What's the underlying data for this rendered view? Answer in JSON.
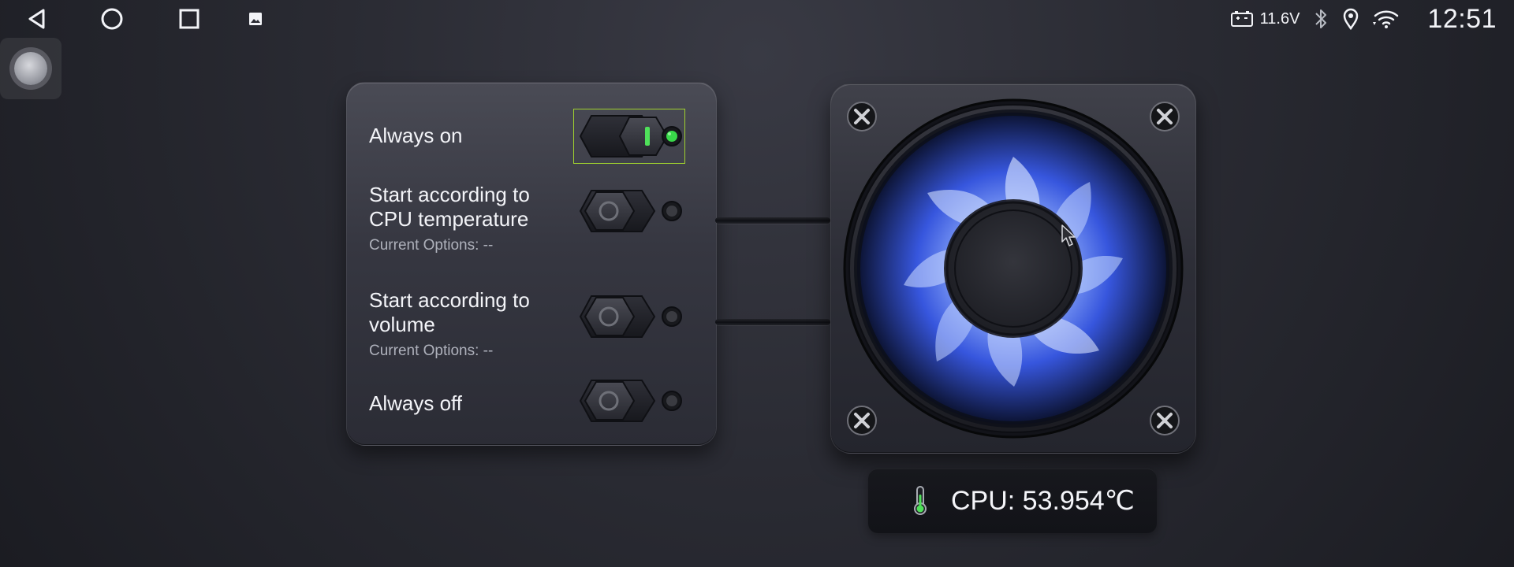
{
  "status_bar": {
    "navigation": {
      "back": {
        "icon": "back-triangle-icon"
      },
      "home": {
        "icon": "home-circle-icon"
      },
      "recents": {
        "icon": "recents-square-icon"
      },
      "gallery": {
        "icon": "image-icon"
      }
    },
    "voltage": {
      "icon": "battery-icon",
      "value": "11.6V"
    },
    "bluetooth": {
      "icon": "bluetooth-icon"
    },
    "location": {
      "icon": "location-pin-icon"
    },
    "wifi": {
      "icon": "wifi-icon"
    },
    "time": "12:51"
  },
  "floating_ball": {
    "icon": "assistive-ball-icon"
  },
  "fan_control": {
    "options": [
      {
        "label": "Always on",
        "enabled": true
      },
      {
        "label": "Start according to CPU temperature",
        "sublabel": "Current Options: --",
        "enabled": false
      },
      {
        "label": "Start according to volume",
        "sublabel": "Current Options: --",
        "enabled": false
      },
      {
        "label": "Always off",
        "enabled": false
      }
    ]
  },
  "fan": {
    "icon": "cooling-fan-icon",
    "screw_icon": "screw-icon",
    "accent_color": "#5b87ff"
  },
  "cpu": {
    "icon": "thermometer-icon",
    "text": "CPU: 53.954℃",
    "indicator_color": "#4fe05a"
  }
}
